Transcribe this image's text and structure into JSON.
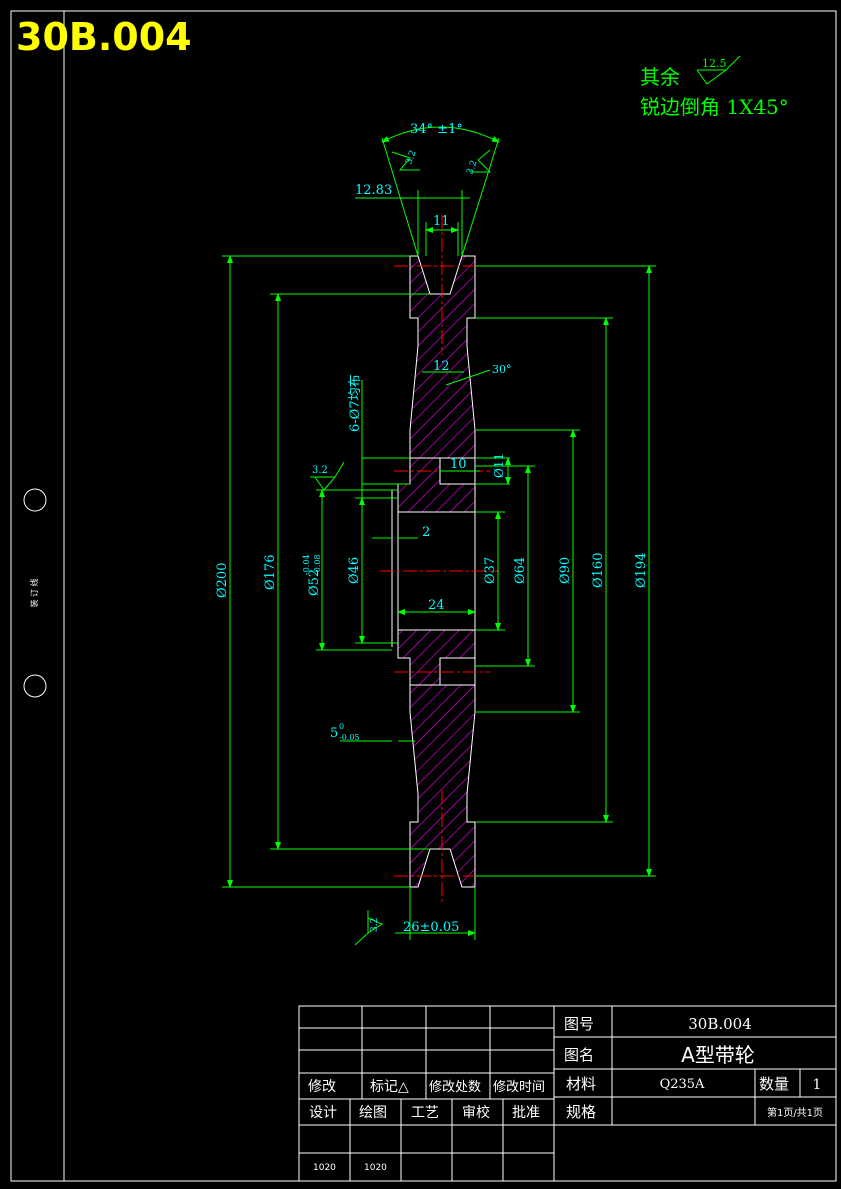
{
  "drawing_number_big": "30B.004",
  "notes": {
    "remaining_label": "其余",
    "remaining_roughness": "12.5",
    "chamfer_note": "锐边倒角 1X45°"
  },
  "binding_label": "装 订 线",
  "dims": {
    "groove_angle": "34° ±1°",
    "groove_top_width": "12.83",
    "groove_bottom_width": "11",
    "roughness_groove": "3.2",
    "web_thickness": "12",
    "web_angle": "30°",
    "holes": "6-Ø7均布",
    "hole_depth": "10",
    "hole_dia": "Ø11",
    "roughness_hub": "3.2",
    "keyway_offset": "2",
    "hub_length": "24",
    "keyway_width": "5",
    "keyway_tol_up": "0",
    "keyway_tol_low": "-0.05",
    "d200": "Ø200",
    "d176": "Ø176",
    "d52": "Ø52",
    "d52_tol_up": "-0.04",
    "d52_tol_low": "-0.08",
    "d46": "Ø46",
    "d37": "Ø37",
    "d64": "Ø64",
    "d90": "Ø90",
    "d160": "Ø160",
    "d194": "Ø194",
    "roughness_width": "3.2",
    "width": "26±0.05"
  },
  "title_block": {
    "fig_no_label": "图号",
    "fig_no": "30B.004",
    "name_label": "图名",
    "name": "A型带轮",
    "material_label": "材料",
    "material": "Q235A",
    "qty_label": "数量",
    "qty": "1",
    "spec_label": "规格",
    "page": "第1页/共1页",
    "rev_labels": [
      "修改",
      "标记△",
      "修改处数",
      "修改时间"
    ],
    "sign_labels": [
      "设计",
      "绘图",
      "工艺",
      "审校",
      "批准"
    ],
    "dates": [
      "1020",
      "1020"
    ]
  },
  "colors": {
    "frame": "#ffffff",
    "dimension": "#00ff00",
    "text": "#00ffff",
    "hatch": "#ff00ff",
    "centerline": "#ff0000",
    "title": "#ffff00"
  }
}
